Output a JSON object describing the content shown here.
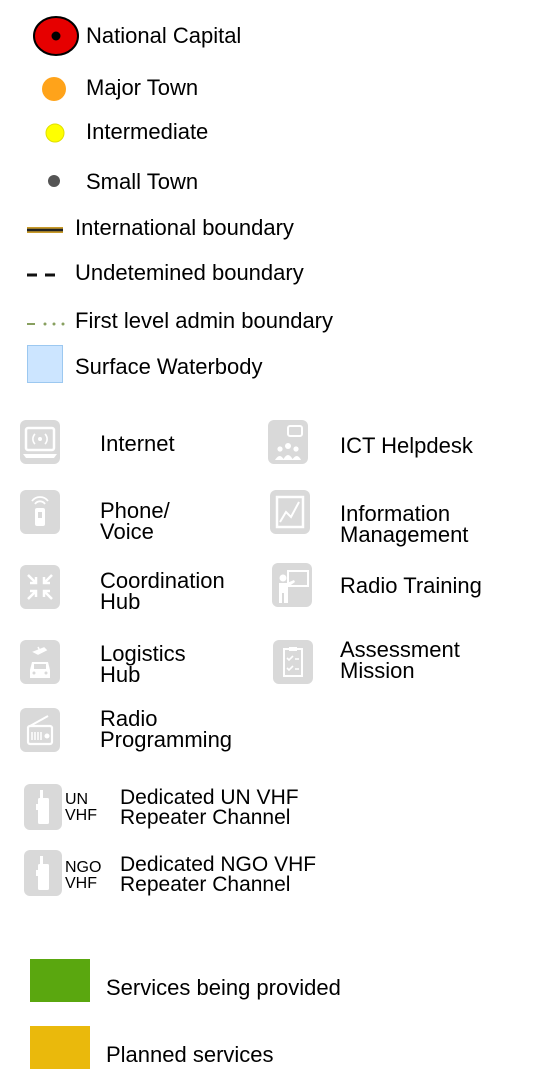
{
  "map_legend": {
    "settlements": [
      {
        "label": "National Capital",
        "symbol": "national-capital"
      },
      {
        "label": "Major Town",
        "symbol": "major-town"
      },
      {
        "label": "Intermediate",
        "symbol": "intermediate"
      },
      {
        "label": "Small Town",
        "symbol": "small-town"
      }
    ],
    "boundaries": [
      {
        "label": "International boundary"
      },
      {
        "label": "Undetemined boundary"
      },
      {
        "label": "First level admin boundary"
      }
    ],
    "water": {
      "label": "Surface Waterbody"
    },
    "services": [
      {
        "label": "Internet",
        "icon": "internet-icon"
      },
      {
        "label": "ICT Helpdesk",
        "icon": "ict-helpdesk-icon"
      },
      {
        "label": "Phone/\nVoice",
        "icon": "phone-voice-icon"
      },
      {
        "label": "Information\nManagement",
        "icon": "information-management-icon"
      },
      {
        "label": "Coordination\nHub",
        "icon": "coordination-hub-icon"
      },
      {
        "label": "Radio Training",
        "icon": "radio-training-icon"
      },
      {
        "label": "Logistics\nHub",
        "icon": "logistics-hub-icon"
      },
      {
        "label": "Assessment\nMission",
        "icon": "assessment-mission-icon"
      },
      {
        "label": "Radio\nProgramming",
        "icon": "radio-programming-icon"
      }
    ],
    "repeaters": [
      {
        "tag": "UN\nVHF",
        "label": "Dedicated UN VHF\nRepeater Channel",
        "icon": "radio-handset-icon"
      },
      {
        "tag": "NGO\nVHF",
        "label": "Dedicated NGO VHF\nRepeater Channel",
        "icon": "radio-handset-icon"
      }
    ],
    "status": [
      {
        "label": "Services being provided",
        "color": "#5aa70f"
      },
      {
        "label": "Planned services",
        "color": "#eab90c"
      }
    ],
    "colors": {
      "capital_ring": "#e60000",
      "major_town": "#ffa31a",
      "intermediate": "#ffff00",
      "small_town": "#555555",
      "waterbody_fill": "#cce5ff",
      "waterbody_border": "#9cc8f0",
      "international_line": "#c89a2a",
      "admin_line": "#88a060",
      "icon_tile": "#d9d9d9"
    }
  }
}
